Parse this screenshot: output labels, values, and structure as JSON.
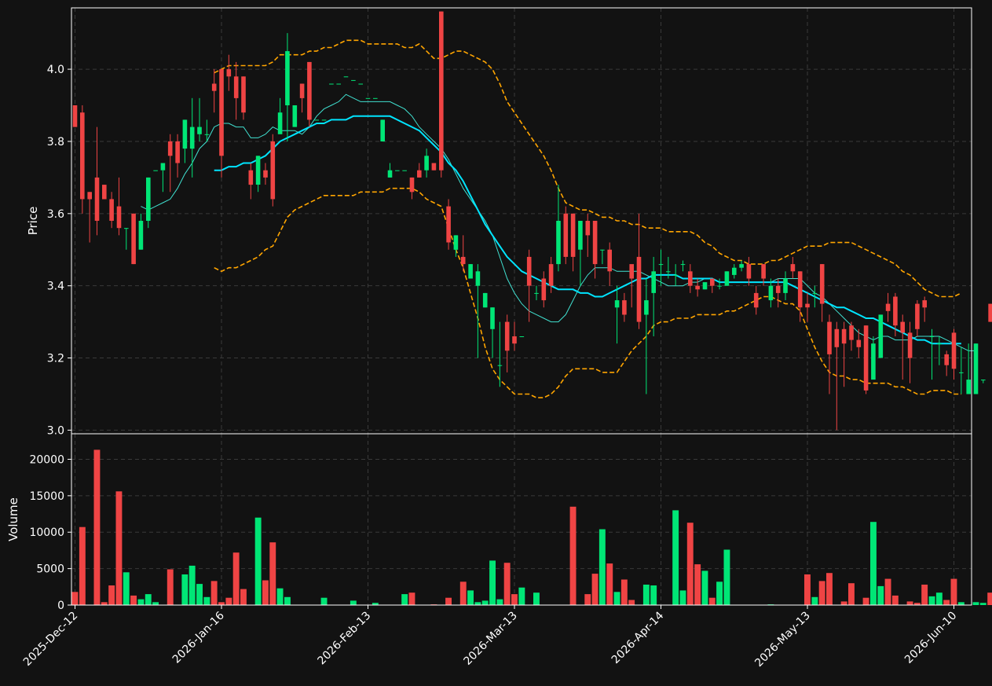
{
  "colors": {
    "background": "#121212",
    "up": "#00e676",
    "down": "#ef4444",
    "ma_fast": "#40e0d0",
    "ma_slow": "#00e5ff",
    "bands": "#ffa500",
    "grid": "#3a3a3a",
    "axis": "#ffffff"
  },
  "chart_data": [
    {
      "type": "candlestick",
      "panel": "price",
      "ylabel": "Price",
      "ylim": [
        2.99,
        4.17
      ],
      "yticks": [
        3.0,
        3.2,
        3.4,
        3.6,
        3.8,
        4.0
      ],
      "ytick_labels": [
        "3.0",
        "3.2",
        "3.4",
        "3.6",
        "3.8",
        "4.0"
      ],
      "grid": true,
      "x_dates": [
        "2025-12-12",
        "2025-12-15",
        "2025-12-16",
        "2025-12-17",
        "2025-12-18",
        "2025-12-19",
        "2025-12-22",
        "2025-12-23",
        "2025-12-24",
        "2025-12-26",
        "2025-12-29",
        "2025-12-30",
        "2025-12-31",
        "2026-01-02",
        "2026-01-05",
        "2026-01-06",
        "2026-01-07",
        "2026-01-08",
        "2026-01-09",
        "2026-01-12",
        "2026-01-13",
        "2026-01-14",
        "2026-01-15",
        "2026-01-16",
        "2026-01-20",
        "2026-01-21",
        "2026-01-22",
        "2026-01-23",
        "2026-01-26",
        "2026-01-27",
        "2026-01-28",
        "2026-01-29",
        "2026-01-30",
        "2026-02-02",
        "2026-02-03",
        "2026-02-04",
        "2026-02-05",
        "2026-02-06",
        "2026-02-09",
        "2026-02-10",
        "2026-02-11",
        "2026-02-12",
        "2026-02-13",
        "2026-02-17",
        "2026-02-18",
        "2026-02-19",
        "2026-02-20",
        "2026-02-23",
        "2026-02-24",
        "2026-02-25",
        "2026-02-26",
        "2026-02-27",
        "2026-03-02",
        "2026-03-03",
        "2026-03-04",
        "2026-03-05",
        "2026-03-06",
        "2026-03-09",
        "2026-03-10",
        "2026-03-11",
        "2026-03-12",
        "2026-03-13",
        "2026-03-16",
        "2026-03-17",
        "2026-03-18",
        "2026-03-19",
        "2026-03-20",
        "2026-03-23",
        "2026-03-24",
        "2026-03-25",
        "2026-03-26",
        "2026-03-27",
        "2026-03-30",
        "2026-03-31",
        "2026-04-01",
        "2026-04-02",
        "2026-04-03",
        "2026-04-06",
        "2026-04-07",
        "2026-04-08",
        "2026-04-09",
        "2026-04-10",
        "2026-04-13",
        "2026-04-14",
        "2026-04-15",
        "2026-04-16",
        "2026-04-17",
        "2026-04-20",
        "2026-04-21",
        "2026-04-22",
        "2026-04-23",
        "2026-04-24",
        "2026-04-27",
        "2026-04-28",
        "2026-04-29",
        "2026-04-30",
        "2026-05-01",
        "2026-05-04",
        "2026-05-05",
        "2026-05-06",
        "2026-05-07",
        "2026-05-08",
        "2026-05-11",
        "2026-05-12",
        "2026-05-13",
        "2026-05-14",
        "2026-05-15",
        "2026-05-18",
        "2026-05-19",
        "2026-05-20",
        "2026-05-21",
        "2026-05-22",
        "2026-05-26",
        "2026-05-27",
        "2026-05-28",
        "2026-05-29",
        "2026-06-01",
        "2026-06-02",
        "2026-06-03",
        "2026-06-04",
        "2026-06-05",
        "2026-06-08",
        "2026-06-09",
        "2026-06-10"
      ],
      "open": [
        3.9,
        3.88,
        3.66,
        3.7,
        3.68,
        3.64,
        3.62,
        3.56,
        3.6,
        3.5,
        3.58,
        3.72,
        3.72,
        3.8,
        3.8,
        3.78,
        3.78,
        3.82,
        3.82,
        3.96,
        4.0,
        4.0,
        3.98,
        3.98,
        3.72,
        3.68,
        3.72,
        3.8,
        3.82,
        3.9,
        3.84,
        3.96,
        4.02,
        3.86,
        3.86,
        3.96,
        3.96,
        3.98,
        3.97,
        3.96,
        3.92,
        3.92,
        3.8,
        3.7,
        3.72,
        3.72,
        3.7,
        3.72,
        3.72,
        3.74,
        4.16,
        3.62,
        3.5,
        3.48,
        3.42,
        3.4,
        3.34,
        3.28,
        3.18,
        3.3,
        3.26,
        3.26,
        3.48,
        3.38,
        3.42,
        3.46,
        3.46,
        3.6,
        3.6,
        3.5,
        3.58,
        3.58,
        3.5,
        3.5,
        3.34,
        3.36,
        3.46,
        3.48,
        3.32,
        3.38,
        3.46,
        3.44,
        3.43,
        3.46,
        3.44,
        3.4,
        3.39,
        3.42,
        3.4,
        3.4,
        3.43,
        3.45,
        3.46,
        3.38,
        3.46,
        3.36,
        3.4,
        3.38,
        3.46,
        3.44,
        3.35,
        3.38,
        3.46,
        3.3,
        3.28,
        3.28,
        3.29,
        3.25,
        3.29,
        3.14,
        3.2,
        3.35,
        3.37,
        3.3,
        3.27,
        3.35,
        3.36,
        3.26,
        3.24,
        3.21,
        3.27,
        3.16,
        3.1,
        3.1,
        3.14,
        3.35
      ],
      "close": [
        3.84,
        3.64,
        3.64,
        3.58,
        3.64,
        3.58,
        3.56,
        3.56,
        3.46,
        3.58,
        3.7,
        3.72,
        3.74,
        3.76,
        3.74,
        3.86,
        3.84,
        3.84,
        3.82,
        3.94,
        3.76,
        3.98,
        3.92,
        3.88,
        3.68,
        3.76,
        3.7,
        3.64,
        3.88,
        4.05,
        3.9,
        3.92,
        3.86,
        3.86,
        3.86,
        3.96,
        3.96,
        3.98,
        3.97,
        3.96,
        3.92,
        3.92,
        3.86,
        3.72,
        3.72,
        3.72,
        3.66,
        3.7,
        3.76,
        3.72,
        3.72,
        3.52,
        3.54,
        3.46,
        3.46,
        3.44,
        3.38,
        3.34,
        3.18,
        3.22,
        3.24,
        3.26,
        3.4,
        3.38,
        3.36,
        3.4,
        3.58,
        3.48,
        3.48,
        3.58,
        3.54,
        3.46,
        3.5,
        3.44,
        3.36,
        3.32,
        3.42,
        3.3,
        3.36,
        3.44,
        3.46,
        3.44,
        3.43,
        3.46,
        3.4,
        3.39,
        3.41,
        3.4,
        3.4,
        3.44,
        3.45,
        3.46,
        3.42,
        3.34,
        3.42,
        3.4,
        3.38,
        3.42,
        3.44,
        3.34,
        3.34,
        3.38,
        3.35,
        3.21,
        3.23,
        3.24,
        3.25,
        3.23,
        3.11,
        3.24,
        3.32,
        3.33,
        3.29,
        3.27,
        3.2,
        3.28,
        3.34,
        3.26,
        3.24,
        3.18,
        3.17,
        3.16,
        3.14,
        3.24,
        3.14,
        3.3
      ],
      "high": [
        3.9,
        3.9,
        3.66,
        3.84,
        3.68,
        3.66,
        3.7,
        3.56,
        3.6,
        3.6,
        3.7,
        3.72,
        3.72,
        3.82,
        3.82,
        3.86,
        3.92,
        3.92,
        3.86,
        4.0,
        4.0,
        4.04,
        4.02,
        3.98,
        3.74,
        3.76,
        3.74,
        3.82,
        3.92,
        4.1,
        3.9,
        3.96,
        4.02,
        3.86,
        3.86,
        3.96,
        3.96,
        3.98,
        3.97,
        3.96,
        3.92,
        3.92,
        3.86,
        3.74,
        3.72,
        3.72,
        3.7,
        3.74,
        3.78,
        3.74,
        4.16,
        3.64,
        3.54,
        3.54,
        3.46,
        3.46,
        3.38,
        3.34,
        3.3,
        3.32,
        3.3,
        3.26,
        3.5,
        3.4,
        3.44,
        3.48,
        3.68,
        3.62,
        3.6,
        3.58,
        3.6,
        3.58,
        3.5,
        3.52,
        3.4,
        3.38,
        3.44,
        3.6,
        3.42,
        3.48,
        3.5,
        3.48,
        3.46,
        3.47,
        3.46,
        3.42,
        3.4,
        3.42,
        3.42,
        3.44,
        3.46,
        3.47,
        3.48,
        3.4,
        3.46,
        3.42,
        3.42,
        3.44,
        3.48,
        3.44,
        3.38,
        3.4,
        3.46,
        3.32,
        3.3,
        3.3,
        3.3,
        3.28,
        3.29,
        3.26,
        3.32,
        3.38,
        3.38,
        3.32,
        3.3,
        3.36,
        3.37,
        3.28,
        3.26,
        3.22,
        3.28,
        3.23,
        3.24,
        3.24,
        3.14,
        3.35
      ],
      "low": [
        3.84,
        3.6,
        3.52,
        3.54,
        3.64,
        3.56,
        3.54,
        3.5,
        3.46,
        3.5,
        3.56,
        3.72,
        3.66,
        3.66,
        3.7,
        3.74,
        3.7,
        3.8,
        3.8,
        3.88,
        3.7,
        3.94,
        3.86,
        3.86,
        3.64,
        3.66,
        3.68,
        3.62,
        3.84,
        3.8,
        3.84,
        3.88,
        3.84,
        3.86,
        3.86,
        3.96,
        3.96,
        3.98,
        3.97,
        3.96,
        3.92,
        3.92,
        3.8,
        3.7,
        3.72,
        3.72,
        3.64,
        3.7,
        3.7,
        3.72,
        3.7,
        3.5,
        3.48,
        3.44,
        3.42,
        3.2,
        3.34,
        3.2,
        3.12,
        3.16,
        3.22,
        3.26,
        3.3,
        3.36,
        3.34,
        3.38,
        3.44,
        3.46,
        3.44,
        3.4,
        3.48,
        3.42,
        3.46,
        3.4,
        3.24,
        3.3,
        3.34,
        3.28,
        3.1,
        3.26,
        3.4,
        3.42,
        3.4,
        3.44,
        3.38,
        3.37,
        3.39,
        3.38,
        3.39,
        3.4,
        3.42,
        3.44,
        3.4,
        3.32,
        3.4,
        3.34,
        3.34,
        3.36,
        3.42,
        3.3,
        3.3,
        3.34,
        3.3,
        3.1,
        3.0,
        3.12,
        3.22,
        3.2,
        3.1,
        3.18,
        3.28,
        3.3,
        3.26,
        3.14,
        3.13,
        3.26,
        3.3,
        3.14,
        3.18,
        3.15,
        3.14,
        3.1,
        3.12,
        3.14,
        3.13,
        3.3
      ],
      "ma_fast": [
        null,
        null,
        null,
        null,
        null,
        null,
        null,
        null,
        null,
        3.62,
        3.61,
        3.62,
        3.63,
        3.64,
        3.67,
        3.71,
        3.74,
        3.78,
        3.8,
        3.84,
        3.85,
        3.85,
        3.84,
        3.84,
        3.81,
        3.81,
        3.82,
        3.84,
        3.83,
        3.83,
        3.83,
        3.82,
        3.84,
        3.87,
        3.89,
        3.9,
        3.91,
        3.93,
        3.92,
        3.91,
        3.91,
        3.91,
        3.91,
        3.91,
        3.9,
        3.89,
        3.87,
        3.84,
        3.82,
        3.8,
        3.78,
        3.75,
        3.71,
        3.67,
        3.64,
        3.61,
        3.58,
        3.54,
        3.48,
        3.42,
        3.38,
        3.35,
        3.33,
        3.32,
        3.31,
        3.3,
        3.3,
        3.32,
        3.36,
        3.4,
        3.43,
        3.45,
        3.45,
        3.45,
        3.44,
        3.44,
        3.44,
        3.44,
        3.43,
        3.42,
        3.41,
        3.4,
        3.4,
        3.4,
        3.41,
        3.41,
        3.42,
        3.42,
        3.41,
        3.41,
        3.41,
        3.41,
        3.41,
        3.41,
        3.41,
        3.41,
        3.42,
        3.42,
        3.42,
        3.42,
        3.4,
        3.38,
        3.37,
        3.35,
        3.33,
        3.31,
        3.29,
        3.27,
        3.26,
        3.25,
        3.26,
        3.26,
        3.25,
        3.25,
        3.25,
        3.26,
        3.26,
        3.26,
        3.26,
        3.25,
        3.24,
        3.23,
        3.22,
        3.22
      ],
      "ma_slow": [
        null,
        null,
        null,
        null,
        null,
        null,
        null,
        null,
        null,
        null,
        null,
        null,
        null,
        null,
        null,
        null,
        null,
        null,
        null,
        3.72,
        3.72,
        3.73,
        3.73,
        3.74,
        3.74,
        3.75,
        3.76,
        3.78,
        3.8,
        3.81,
        3.82,
        3.83,
        3.84,
        3.85,
        3.85,
        3.86,
        3.86,
        3.86,
        3.87,
        3.87,
        3.87,
        3.87,
        3.87,
        3.87,
        3.86,
        3.85,
        3.84,
        3.83,
        3.81,
        3.79,
        3.77,
        3.74,
        3.72,
        3.69,
        3.65,
        3.61,
        3.57,
        3.54,
        3.51,
        3.48,
        3.46,
        3.44,
        3.43,
        3.42,
        3.41,
        3.4,
        3.39,
        3.39,
        3.39,
        3.38,
        3.38,
        3.37,
        3.37,
        3.38,
        3.39,
        3.4,
        3.41,
        3.42,
        3.42,
        3.43,
        3.43,
        3.43,
        3.43,
        3.42,
        3.42,
        3.42,
        3.42,
        3.42,
        3.41,
        3.41,
        3.41,
        3.41,
        3.41,
        3.41,
        3.41,
        3.41,
        3.41,
        3.41,
        3.4,
        3.39,
        3.38,
        3.37,
        3.36,
        3.35,
        3.34,
        3.34,
        3.33,
        3.32,
        3.31,
        3.31,
        3.3,
        3.29,
        3.28,
        3.27,
        3.26,
        3.25,
        3.25,
        3.24,
        3.24,
        3.24,
        3.24,
        3.24
      ],
      "band_upper": [
        null,
        null,
        null,
        null,
        null,
        null,
        null,
        null,
        null,
        null,
        null,
        null,
        null,
        null,
        null,
        null,
        null,
        null,
        null,
        3.99,
        4.0,
        4.01,
        4.01,
        4.01,
        4.01,
        4.01,
        4.01,
        4.02,
        4.04,
        4.04,
        4.04,
        4.04,
        4.05,
        4.05,
        4.06,
        4.06,
        4.07,
        4.08,
        4.08,
        4.08,
        4.07,
        4.07,
        4.07,
        4.07,
        4.07,
        4.06,
        4.06,
        4.07,
        4.05,
        4.03,
        4.03,
        4.04,
        4.05,
        4.05,
        4.04,
        4.03,
        4.02,
        4.0,
        3.96,
        3.91,
        3.88,
        3.85,
        3.82,
        3.79,
        3.76,
        3.72,
        3.67,
        3.63,
        3.62,
        3.61,
        3.61,
        3.6,
        3.59,
        3.59,
        3.58,
        3.58,
        3.57,
        3.57,
        3.56,
        3.56,
        3.56,
        3.55,
        3.55,
        3.55,
        3.55,
        3.54,
        3.52,
        3.51,
        3.49,
        3.48,
        3.47,
        3.47,
        3.46,
        3.46,
        3.46,
        3.47,
        3.47,
        3.48,
        3.49,
        3.5,
        3.51,
        3.51,
        3.51,
        3.52,
        3.52,
        3.52,
        3.52,
        3.51,
        3.5,
        3.49,
        3.48,
        3.47,
        3.46,
        3.44,
        3.43,
        3.41,
        3.39,
        3.38,
        3.37,
        3.37,
        3.37,
        3.38
      ],
      "band_lower": [
        null,
        null,
        null,
        null,
        null,
        null,
        null,
        null,
        null,
        null,
        null,
        null,
        null,
        null,
        null,
        null,
        null,
        null,
        null,
        3.45,
        3.44,
        3.45,
        3.45,
        3.46,
        3.47,
        3.48,
        3.5,
        3.51,
        3.55,
        3.59,
        3.61,
        3.62,
        3.63,
        3.64,
        3.65,
        3.65,
        3.65,
        3.65,
        3.65,
        3.66,
        3.66,
        3.66,
        3.66,
        3.67,
        3.67,
        3.67,
        3.67,
        3.66,
        3.64,
        3.63,
        3.62,
        3.56,
        3.5,
        3.45,
        3.38,
        3.31,
        3.23,
        3.17,
        3.14,
        3.12,
        3.1,
        3.1,
        3.1,
        3.09,
        3.09,
        3.1,
        3.12,
        3.15,
        3.17,
        3.17,
        3.17,
        3.17,
        3.16,
        3.16,
        3.16,
        3.19,
        3.22,
        3.24,
        3.26,
        3.29,
        3.3,
        3.3,
        3.31,
        3.31,
        3.31,
        3.32,
        3.32,
        3.32,
        3.32,
        3.33,
        3.33,
        3.34,
        3.35,
        3.36,
        3.37,
        3.37,
        3.36,
        3.35,
        3.35,
        3.33,
        3.28,
        3.23,
        3.19,
        3.16,
        3.15,
        3.15,
        3.14,
        3.14,
        3.13,
        3.13,
        3.13,
        3.13,
        3.12,
        3.12,
        3.11,
        3.1,
        3.1,
        3.11,
        3.11,
        3.11,
        3.1,
        3.1
      ]
    },
    {
      "type": "bar",
      "panel": "volume",
      "ylabel": "Volume",
      "ylim": [
        0,
        23500
      ],
      "yticks": [
        0,
        5000,
        10000,
        15000,
        20000
      ],
      "ytick_labels": [
        "0",
        "5000",
        "10000",
        "15000",
        "20000"
      ],
      "grid": true,
      "xtick_labels": [
        "2025-Dec-12",
        "2026-Jan-16",
        "2026-Feb-13",
        "2026-Mar-13",
        "2026-Apr-14",
        "2026-May-13",
        "2026-Jun-10"
      ],
      "xtick_index": [
        0,
        20,
        40,
        60,
        80,
        100,
        120
      ],
      "values": [
        1800,
        10700,
        0,
        21300,
        400,
        2700,
        15600,
        4500,
        1300,
        800,
        1500,
        400,
        0,
        4900,
        0,
        4200,
        5400,
        2900,
        1100,
        3300,
        400,
        1000,
        7200,
        2200,
        0,
        12000,
        3400,
        8600,
        2300,
        1100,
        0,
        0,
        0,
        0,
        1000,
        0,
        0,
        0,
        600,
        0,
        0,
        300,
        0,
        0,
        0,
        1500,
        1700,
        0,
        0,
        100,
        0,
        1000,
        0,
        3200,
        2000,
        400,
        600,
        6100,
        800,
        5800,
        1500,
        2400,
        0,
        1700,
        0,
        0,
        0,
        0,
        13500,
        0,
        1500,
        4300,
        10400,
        5700,
        1800,
        3500,
        700,
        0,
        2800,
        2700,
        0,
        0,
        13000,
        2000,
        11300,
        5600,
        4700,
        1000,
        3200,
        7600,
        0,
        0,
        0,
        0,
        0,
        100,
        0,
        0,
        0,
        0,
        4200,
        1100,
        3300,
        4400,
        0,
        500,
        3000,
        0,
        1000,
        11400,
        2600,
        3600,
        1300,
        0,
        500,
        300,
        2800,
        1200,
        1700,
        700,
        3600,
        400,
        0,
        400,
        300,
        1700,
        900,
        0,
        300,
        9200,
        0,
        1500
      ]
    }
  ]
}
